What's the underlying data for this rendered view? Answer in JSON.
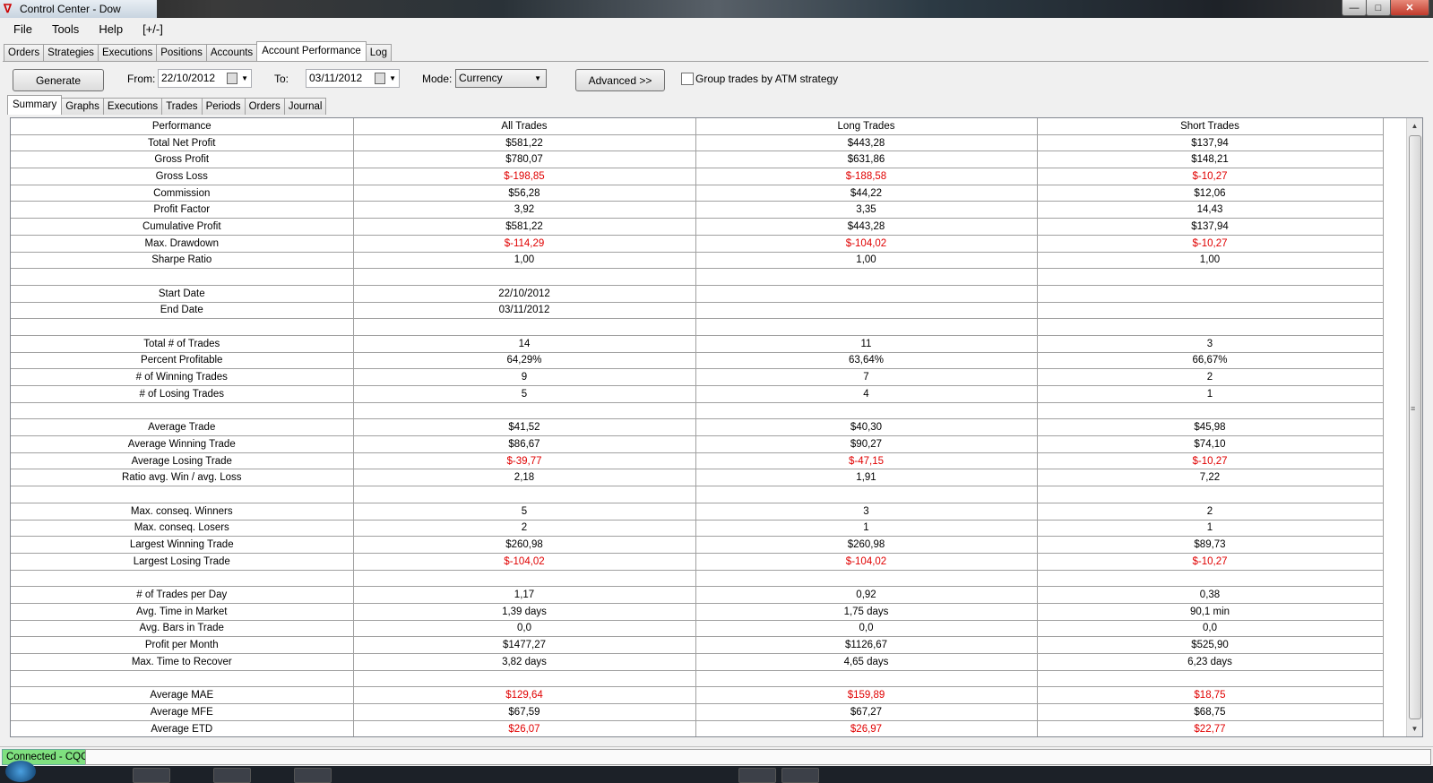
{
  "window": {
    "title": "Control Center - Dow",
    "icon": "ninjatrader-logo-icon",
    "buttons": {
      "minimize": "—",
      "maximize": "□",
      "close": "✕"
    }
  },
  "menu": [
    "File",
    "Tools",
    "Help",
    "[+/-]"
  ],
  "main_tabs": [
    "Orders",
    "Strategies",
    "Executions",
    "Positions",
    "Accounts",
    "Account Performance",
    "Log"
  ],
  "main_tabs_active": "Account Performance",
  "toolbar": {
    "generate_label": "Generate",
    "from_label": "From:",
    "from_value": "22/10/2012",
    "to_label": "To:",
    "to_value": "03/11/2012",
    "mode_label": "Mode:",
    "mode_value": "Currency",
    "advanced_label": "Advanced >>",
    "group_label": "Group trades by ATM strategy"
  },
  "sub_tabs": [
    "Summary",
    "Graphs",
    "Executions",
    "Trades",
    "Periods",
    "Orders",
    "Journal"
  ],
  "sub_tabs_active": "Summary",
  "table": {
    "headers": [
      "Performance",
      "All Trades",
      "Long Trades",
      "Short Trades"
    ],
    "rows": [
      [
        "Total Net Profit",
        "$581,22",
        "$443,28",
        "$137,94"
      ],
      [
        "Gross Profit",
        "$780,07",
        "$631,86",
        "$148,21"
      ],
      [
        "Gross Loss",
        "$-198,85",
        "$-188,58",
        "$-10,27"
      ],
      [
        "Commission",
        "$56,28",
        "$44,22",
        "$12,06"
      ],
      [
        "Profit Factor",
        "3,92",
        "3,35",
        "14,43"
      ],
      [
        "Cumulative Profit",
        "$581,22",
        "$443,28",
        "$137,94"
      ],
      [
        "Max. Drawdown",
        "$-114,29",
        "$-104,02",
        "$-10,27"
      ],
      [
        "Sharpe Ratio",
        "1,00",
        "1,00",
        "1,00"
      ],
      [
        "",
        "",
        "",
        ""
      ],
      [
        "Start Date",
        "22/10/2012",
        "",
        ""
      ],
      [
        "End Date",
        "03/11/2012",
        "",
        ""
      ],
      [
        "",
        "",
        "",
        ""
      ],
      [
        "Total # of Trades",
        "14",
        "11",
        "3"
      ],
      [
        "Percent Profitable",
        "64,29%",
        "63,64%",
        "66,67%"
      ],
      [
        "# of Winning Trades",
        "9",
        "7",
        "2"
      ],
      [
        "# of Losing Trades",
        "5",
        "4",
        "1"
      ],
      [
        "",
        "",
        "",
        ""
      ],
      [
        "Average Trade",
        "$41,52",
        "$40,30",
        "$45,98"
      ],
      [
        "Average Winning Trade",
        "$86,67",
        "$90,27",
        "$74,10"
      ],
      [
        "Average Losing Trade",
        "$-39,77",
        "$-47,15",
        "$-10,27"
      ],
      [
        "Ratio avg. Win / avg. Loss",
        "2,18",
        "1,91",
        "7,22"
      ],
      [
        "",
        "",
        "",
        ""
      ],
      [
        "Max. conseq. Winners",
        "5",
        "3",
        "2"
      ],
      [
        "Max. conseq. Losers",
        "2",
        "1",
        "1"
      ],
      [
        "Largest Winning Trade",
        "$260,98",
        "$260,98",
        "$89,73"
      ],
      [
        "Largest Losing Trade",
        "$-104,02",
        "$-104,02",
        "$-10,27"
      ],
      [
        "",
        "",
        "",
        ""
      ],
      [
        "# of Trades per Day",
        "1,17",
        "0,92",
        "0,38"
      ],
      [
        "Avg. Time in Market",
        "1,39 days",
        "1,75 days",
        "90,1 min"
      ],
      [
        "Avg. Bars in Trade",
        "0,0",
        "0,0",
        "0,0"
      ],
      [
        "Profit per Month",
        "$1477,27",
        "$1126,67",
        "$525,90"
      ],
      [
        "Max. Time to Recover",
        "3,82 days",
        "4,65 days",
        "6,23 days"
      ],
      [
        "",
        "",
        "",
        ""
      ],
      [
        "Average MAE",
        "$129,64",
        "$159,89",
        "$18,75"
      ],
      [
        "Average MFE",
        "$67,59",
        "$67,27",
        "$68,75"
      ],
      [
        "Average ETD",
        "$26,07",
        "$26,97",
        "$22,77"
      ]
    ],
    "red_rows": [
      "Gross Loss",
      "Max. Drawdown",
      "Average Losing Trade",
      "Largest Losing Trade",
      "Average MAE",
      "Average ETD"
    ]
  },
  "status": {
    "connection": "Connected - CQG"
  },
  "colors": {
    "negative": "#e00000",
    "connected": "#7fe07f"
  }
}
